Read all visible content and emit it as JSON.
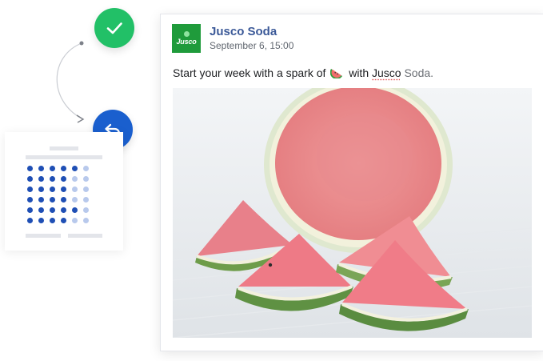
{
  "post": {
    "page_name": "Jusco Soda",
    "avatar_text": "Jusco",
    "date": "September 6,  15:00",
    "text_before": "Start your week with a spark of",
    "text_with": "with",
    "text_brand": "Jusco",
    "text_after": "Soda.",
    "emoji_icon": "watermelon-emoji-icon"
  },
  "widget": {
    "check_icon": "check-icon",
    "reply_icon": "reply-icon",
    "colors": {
      "check": "#22c067",
      "reply": "#1a5fce",
      "dot_dark": "#1f4fb5",
      "dot_light": "#b8c9ec"
    }
  },
  "colors": {
    "page_name": "#3b5998",
    "avatar_bg": "#1f9b3b"
  }
}
